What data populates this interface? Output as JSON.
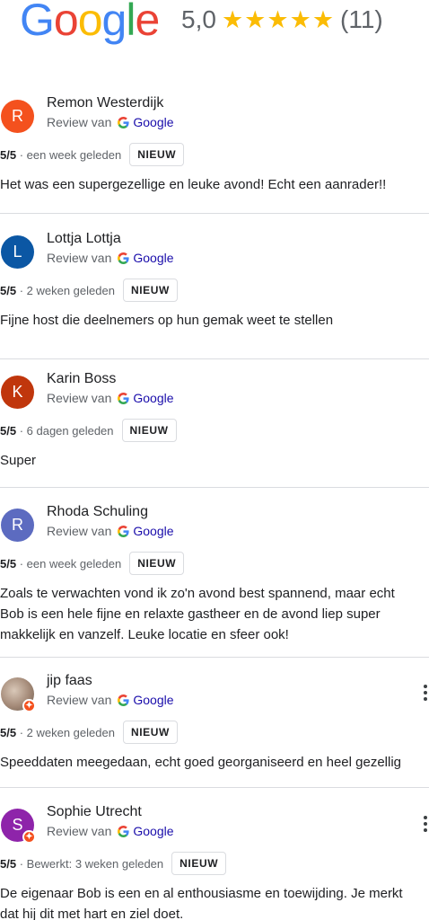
{
  "header": {
    "logo_letters": [
      "G",
      "o",
      "o",
      "g",
      "l",
      "e"
    ],
    "score": "5,0",
    "stars": 5,
    "count": "(11)"
  },
  "reviews": [
    {
      "avatar_letter": "R",
      "avatar_color": "#f4511e",
      "author": "Remon Westerdijk",
      "source_prefix": "Review van",
      "source_label": "Google",
      "score": "5/5",
      "time": "· een week geleden",
      "badge": "NIEUW",
      "lines": [
        "Het was een supergezellige en leuke avond! Echt een aanrader!!"
      ]
    },
    {
      "avatar_letter": "L",
      "avatar_color": "#0b57a4",
      "author": "Lottja Lottja",
      "source_prefix": "Review van",
      "source_label": "Google",
      "score": "5/5",
      "time": "· 2 weken geleden",
      "badge": "NIEUW",
      "lines": [
        "Fijne host die deelnemers op hun gemak weet te stellen"
      ]
    },
    {
      "avatar_letter": "K",
      "avatar_color": "#c0360c",
      "author": "Karin Boss",
      "source_prefix": "Review van",
      "source_label": "Google",
      "score": "5/5",
      "time": "· 6 dagen geleden",
      "badge": "NIEUW",
      "lines": [
        "Super"
      ]
    },
    {
      "avatar_letter": "R",
      "avatar_color": "#5c6bc0",
      "author": "Rhoda Schuling",
      "source_prefix": "Review van",
      "source_label": "Google",
      "score": "5/5",
      "time": "· een week geleden",
      "badge": "NIEUW",
      "lines": [
        "Zoals te verwachten vond ik zo'n avond best spannend, maar echt",
        "Bob is een hele fijne en relaxte gastheer en de avond liep super",
        "makkelijk en vanzelf. Leuke locatie en sfeer ook!"
      ]
    },
    {
      "avatar_letter": "",
      "avatar_color": "#a48a78",
      "author": "jip faas",
      "source_prefix": "Review van",
      "source_label": "Google",
      "score": "5/5",
      "time": "· 2 weken geleden",
      "badge": "NIEUW",
      "lines": [
        "Speeddaten meegedaan, echt goed georganiseerd en heel gezellig"
      ]
    },
    {
      "avatar_letter": "S",
      "avatar_color": "#8e24aa",
      "author": "Sophie Utrecht",
      "source_prefix": "Review van",
      "source_label": "Google",
      "score": "5/5",
      "time": "· Bewerkt: 3 weken geleden",
      "badge": "NIEUW",
      "lines": [
        "De eigenaar Bob is een en al enthousiasme en toewijding. Je merkt",
        "dat hij dit met hart en ziel doet."
      ]
    }
  ]
}
